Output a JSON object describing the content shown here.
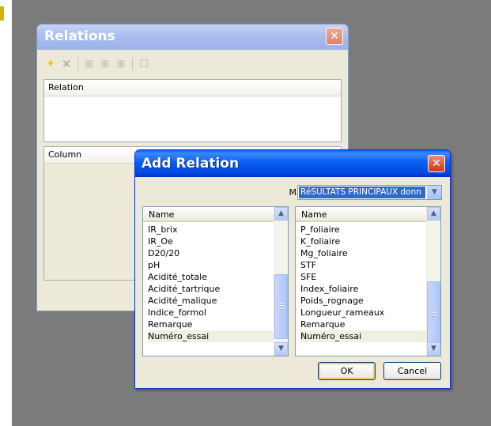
{
  "relations_window": {
    "title": "Relations",
    "relation_header": "Relation",
    "column_header": "Column",
    "toolbar": [
      "add-icon",
      "delete-icon",
      "join-icon",
      "join-icon",
      "join-icon",
      "properties-icon"
    ]
  },
  "add_relation_dialog": {
    "title": "Add Relation",
    "match_label": "Match key fields in:",
    "match_value": "RéSULTATS PRINCIPAUX donn",
    "left_list": {
      "header": "Name",
      "items": [
        "IR_brix",
        "IR_Oe",
        "D20/20",
        "pH",
        "Acidité_totale",
        "Acidité_tartrique",
        "Acidité_malique",
        "Indice_formol",
        "Remarque",
        "Numéro_essai"
      ],
      "selected": "Numéro_essai"
    },
    "right_list": {
      "header": "Name",
      "items": [
        "P_foliaire",
        "K_foliaire",
        "Mg_foliaire",
        "STF",
        "SFE",
        "Index_foliaire",
        "Poids_rognage",
        "Longueur_rameaux",
        "Remarque",
        "Numéro_essai"
      ],
      "selected": "Numéro_essai"
    },
    "ok_label": "OK",
    "cancel_label": "Cancel"
  },
  "colors": {
    "desktop": "#7b7b7b",
    "dialog_title_blue": "#0a5ef4",
    "selection_blue": "#316ac5"
  }
}
